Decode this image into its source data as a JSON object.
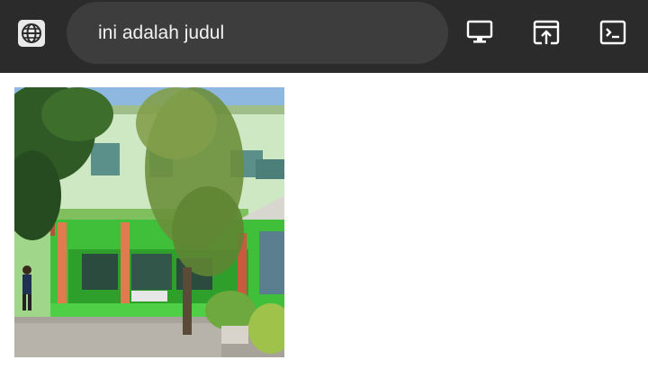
{
  "window": {
    "title": "ini adalah judul"
  },
  "icons": {
    "site": "globe-icon",
    "desktop": "desktop-icon",
    "open_in_app": "open-in-new-window-icon",
    "terminal": "terminal-icon"
  },
  "colors": {
    "toolbar_bg": "#2b2b2b",
    "title_pill_bg": "#3d3d3d",
    "title_text": "#f2f2f2",
    "icon": "#ffffff",
    "page_bg": "#ffffff"
  }
}
